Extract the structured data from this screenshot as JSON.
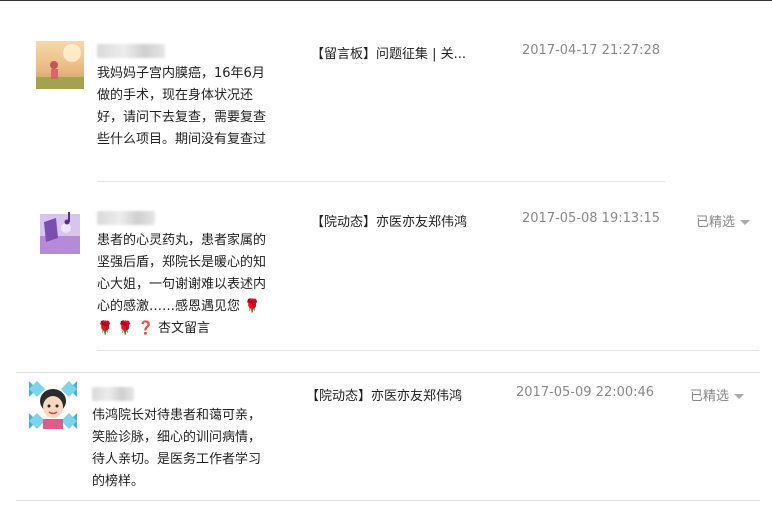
{
  "comments": [
    {
      "content": "我妈妈子宫内膜癌，16年6月做的手术，现在身体状况还好，请问下去复查，需要复查些什么项目。期间没有复查过",
      "article": "【留言板】问题征集 | 关...",
      "time": "2017-04-17 21:27:28",
      "status": ""
    },
    {
      "content": "患者的心灵药丸，患者家属的坚强后盾，郑院长是暖心的知心大姐，一句谢谢难以表述内心的感激……感恩遇见您",
      "content_suffix": "杏文留言",
      "emoji_icons": [
        "rose-icon",
        "rose-icon",
        "rose-icon",
        "question-mark-icon"
      ],
      "article": "【院动态】亦医亦友郑伟鸿",
      "time": "2017-05-08 19:13:15",
      "status": "已精选"
    },
    {
      "content": "伟鸿院长对待患者和蔼可亲，笑脸诊脉，细心的训问病情，待人亲切。是医务工作者学习的榜样。",
      "article": "【院动态】亦医亦友郑伟鸿",
      "time": "2017-05-09 22:00:46",
      "status": "已精选"
    }
  ],
  "colors": {
    "text": "#222222",
    "muted": "#888888",
    "divider": "#e4e4e4"
  }
}
